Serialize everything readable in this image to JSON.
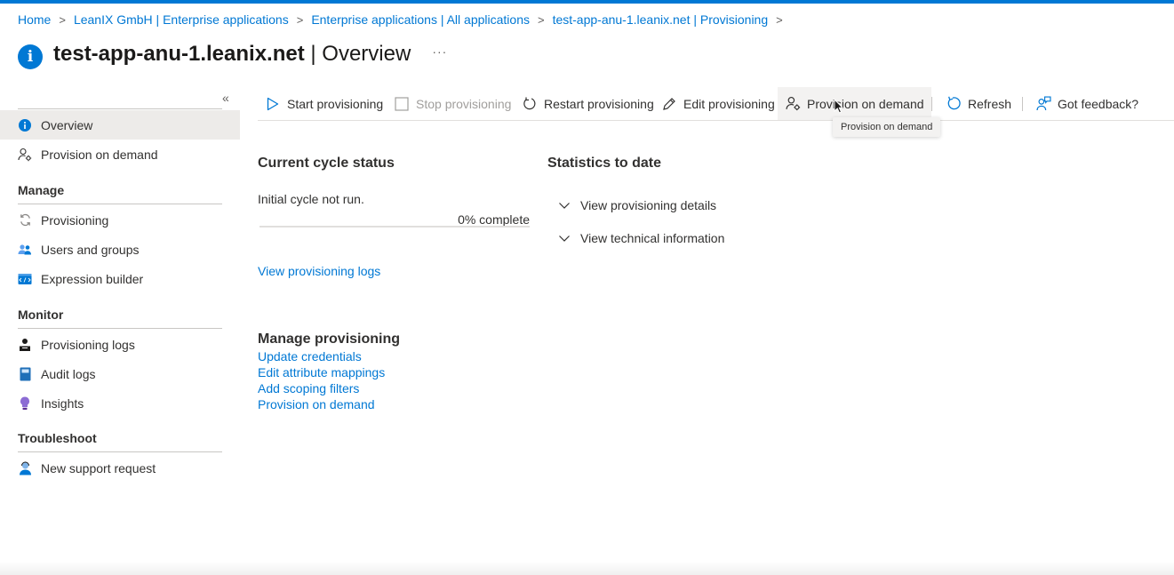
{
  "colors": {
    "accent": "#0078d4",
    "active_bg": "#edebe9",
    "text": "#323130",
    "disabled": "#a19f9d"
  },
  "breadcrumb": [
    {
      "label": "Home"
    },
    {
      "label": "LeanIX GmbH | Enterprise applications"
    },
    {
      "label": "Enterprise applications | All applications"
    },
    {
      "label": "test-app-anu-1.leanix.net | Provisioning"
    }
  ],
  "header": {
    "title_bold": "test-app-anu-1.leanix.net",
    "title_rest": " | Overview",
    "more_label": "···",
    "icon": "info-icon"
  },
  "sidebar": {
    "collapse_label": "«",
    "items": [
      {
        "label": "Overview",
        "icon": "info-icon",
        "active": true
      },
      {
        "label": "Provision on demand",
        "icon": "person-gear-icon"
      }
    ],
    "groups": [
      {
        "title": "Manage",
        "items": [
          {
            "label": "Provisioning",
            "icon": "sync-icon"
          },
          {
            "label": "Users and groups",
            "icon": "users-icon"
          },
          {
            "label": "Expression builder",
            "icon": "code-icon"
          }
        ]
      },
      {
        "title": "Monitor",
        "items": [
          {
            "label": "Provisioning logs",
            "icon": "person-log-icon"
          },
          {
            "label": "Audit logs",
            "icon": "book-icon"
          },
          {
            "label": "Insights",
            "icon": "lightbulb-icon"
          }
        ]
      },
      {
        "title": "Troubleshoot",
        "items": [
          {
            "label": "New support request",
            "icon": "support-person-icon"
          }
        ]
      }
    ]
  },
  "toolbar": {
    "start": "Start provisioning",
    "stop": "Stop provisioning",
    "restart": "Restart provisioning",
    "edit": "Edit provisioning",
    "provision_on_demand": "Provision on demand",
    "refresh": "Refresh",
    "feedback": "Got feedback?",
    "tooltip": "Provision on demand"
  },
  "cycle": {
    "title": "Current cycle status",
    "status": "Initial cycle not run.",
    "progress_label": "0% complete",
    "progress_percent": 0,
    "logs_link": "View provisioning logs"
  },
  "statistics": {
    "title": "Statistics to date",
    "details": "View provisioning details",
    "technical": "View technical information"
  },
  "manage": {
    "title": "Manage provisioning",
    "links": [
      "Update credentials",
      "Edit attribute mappings",
      "Add scoping filters",
      "Provision on demand"
    ]
  }
}
